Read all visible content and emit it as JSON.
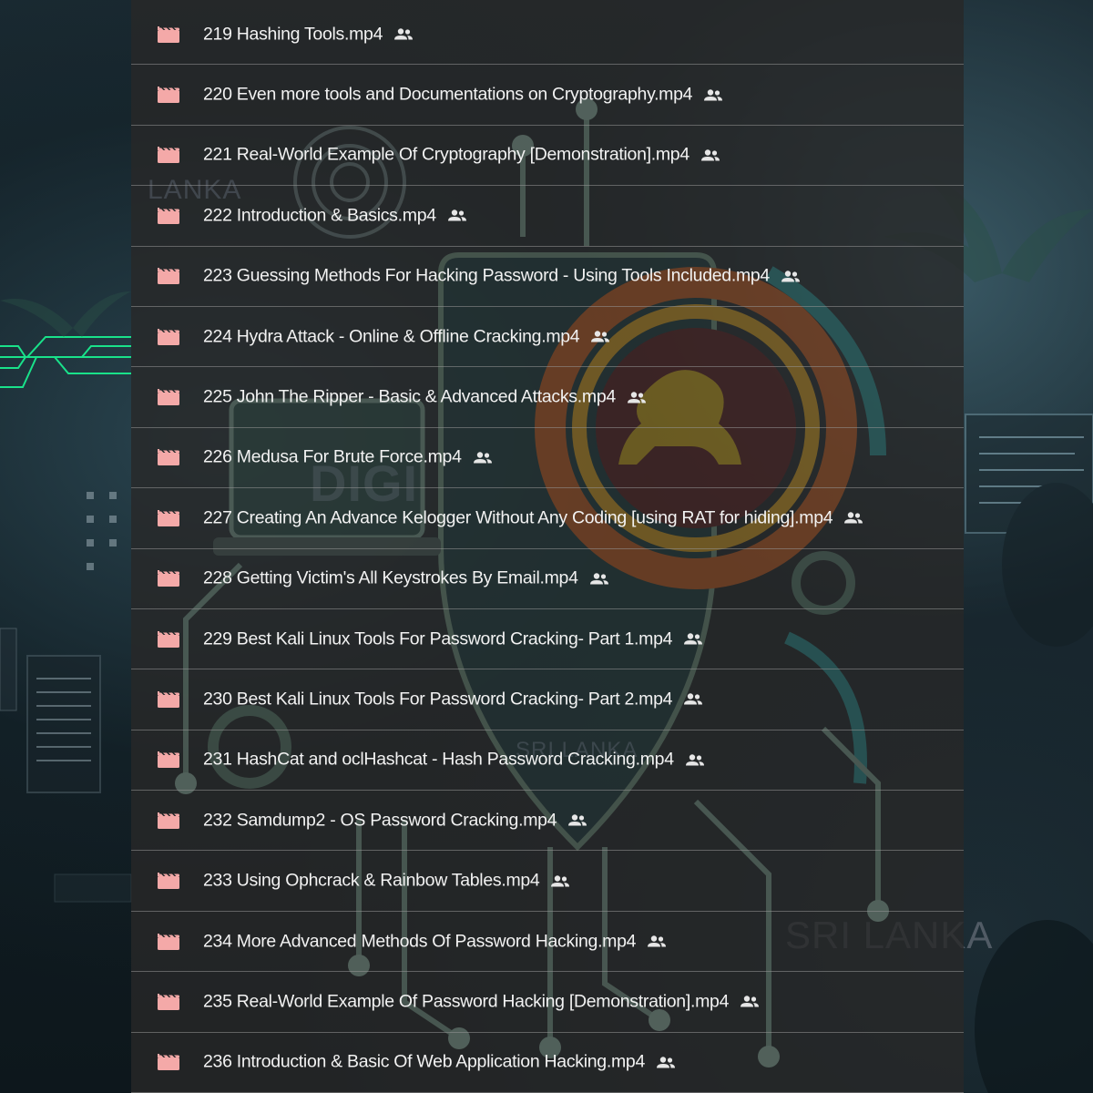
{
  "files": [
    {
      "name": "219 Hashing Tools.mp4",
      "icon": "video-file-icon",
      "shared": true
    },
    {
      "name": "220 Even more tools and Documentations on Cryptography.mp4",
      "icon": "video-file-icon",
      "shared": true
    },
    {
      "name": "221 Real-World Example Of Cryptography [Demonstration].mp4",
      "icon": "video-file-icon",
      "shared": true
    },
    {
      "name": "222 Introduction & Basics.mp4",
      "icon": "video-file-icon",
      "shared": true
    },
    {
      "name": "223 Guessing Methods For Hacking Password - Using Tools Included.mp4",
      "icon": "video-file-icon",
      "shared": true
    },
    {
      "name": "224 Hydra Attack - Online & Offline Cracking.mp4",
      "icon": "video-file-icon",
      "shared": true
    },
    {
      "name": "225 John The Ripper - Basic & Advanced Attacks.mp4",
      "icon": "video-file-icon",
      "shared": true
    },
    {
      "name": "226 Medusa For Brute Force.mp4",
      "icon": "video-file-icon",
      "shared": true
    },
    {
      "name": "227 Creating An Advance Kelogger Without Any Coding [using RAT for hiding].mp4",
      "icon": "video-file-icon",
      "shared": true
    },
    {
      "name": "228 Getting Victim's All Keystrokes By Email.mp4",
      "icon": "video-file-icon",
      "shared": true
    },
    {
      "name": "229 Best Kali Linux Tools For Password Cracking- Part 1.mp4",
      "icon": "video-file-icon",
      "shared": true
    },
    {
      "name": "230 Best Kali Linux Tools For Password Cracking- Part 2.mp4",
      "icon": "video-file-icon",
      "shared": true
    },
    {
      "name": "231 HashCat and oclHashcat - Hash Password Cracking.mp4",
      "icon": "video-file-icon",
      "shared": true
    },
    {
      "name": "232 Samdump2 - OS Password Cracking.mp4",
      "icon": "video-file-icon",
      "shared": true
    },
    {
      "name": "233 Using Ophcrack & Rainbow Tables.mp4",
      "icon": "video-file-icon",
      "shared": true
    },
    {
      "name": "234 More Advanced Methods Of Password Hacking.mp4",
      "icon": "video-file-icon",
      "shared": true
    },
    {
      "name": "235 Real-World Example Of Password Hacking [Demonstration].mp4",
      "icon": "video-file-icon",
      "shared": true
    },
    {
      "name": "236 Introduction & Basic Of Web Application Hacking.mp4",
      "icon": "video-file-icon",
      "shared": true
    }
  ],
  "watermarks": {
    "top_left": "LANKA",
    "center": "DIGI",
    "center_lower": "SRI LANKA",
    "bottom_right": "SRI LANKA"
  },
  "colors": {
    "file_icon": "#f4a9a8",
    "shared_icon": "#e6e6e6",
    "text": "#f2f2f2",
    "row_divider": "#8a8a8a",
    "panel": "#282828",
    "circuit_green": "#19e28a"
  }
}
